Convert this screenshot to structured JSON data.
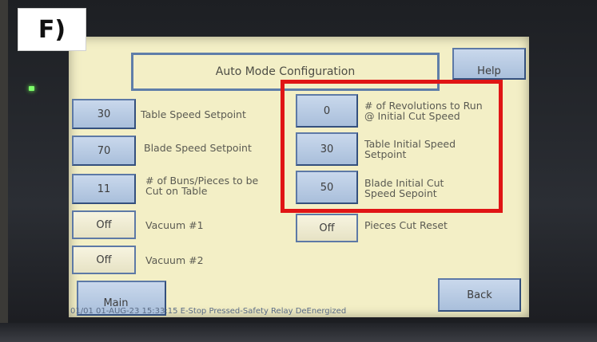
{
  "panel_label": "F)",
  "screen": {
    "title": "Auto Mode Configuration",
    "help_label": "Help",
    "main_label": "Main",
    "back_label": "Back",
    "status_line": "01/01 01-AUG-23 15:33:15 E-Stop Pressed-Safety Relay DeEnergized"
  },
  "left_settings": [
    {
      "value": "30",
      "label_1": "Table Speed Setpoint",
      "label_2": ""
    },
    {
      "value": "70",
      "label_1": "Blade Speed Setpoint",
      "label_2": ""
    },
    {
      "value": "11",
      "label_1": "# of Buns/Pieces to be",
      "label_2": "Cut on Table"
    },
    {
      "value": "Off",
      "label_1": "Vacuum #1",
      "label_2": ""
    },
    {
      "value": "Off",
      "label_1": "Vacuum #2",
      "label_2": ""
    }
  ],
  "right_settings": [
    {
      "value": "0",
      "label_1": "# of Revolutions to Run",
      "label_2": "@ Initial Cut Speed"
    },
    {
      "value": "30",
      "label_1": "Table Initial Speed",
      "label_2": "Setpoint"
    },
    {
      "value": "50",
      "label_1": "Blade Initial Cut",
      "label_2": "Speed Sepoint"
    },
    {
      "value": "Off",
      "label_1": "Pieces Cut Reset",
      "label_2": ""
    }
  ],
  "colors": {
    "screen_bg": "#f3efc6",
    "button_blue": "#a9bfdb",
    "button_border": "#5d79a6",
    "highlight_red": "#e01515",
    "status_led": "#7dff6a"
  }
}
